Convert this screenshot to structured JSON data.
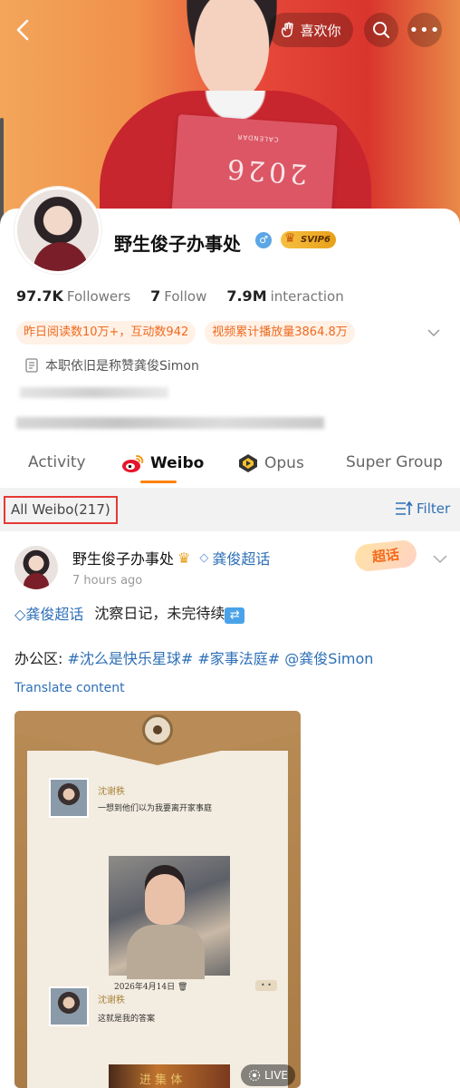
{
  "header": {
    "like_label": "喜欢你",
    "calendar_year": "2026",
    "calendar_word": "CALENDAR"
  },
  "profile": {
    "name": "野生俊子办事处",
    "gender_symbol": "♂",
    "vip_label": "SVIP6",
    "followers_count": "97.7K",
    "followers_label": "Followers",
    "follow_count": "7",
    "follow_label": "Follow",
    "interaction_count": "7.9M",
    "interaction_label": "interaction",
    "tags": [
      "昨日阅读数10万+，互动数942",
      "视频累计播放量3864.8万"
    ],
    "bio": "本职依旧是称赞龚俊Simon"
  },
  "tabs": [
    {
      "label": "Activity",
      "active": false
    },
    {
      "label": "Weibo",
      "active": true
    },
    {
      "label": "Opus",
      "active": false
    },
    {
      "label": "Super Group",
      "active": false
    }
  ],
  "filterbar": {
    "all_weibo_label": "All Weibo(217)",
    "filter_label": "Filter"
  },
  "post": {
    "author": "野生俊子办事处",
    "supertopic": "龚俊超话",
    "time": "7 hours ago",
    "badge": "超话",
    "line1_link": "龚俊超话",
    "line1_text": "沈察日记，未完待续",
    "line2_prefix": "办公区:",
    "line2_links": "#沈么是快乐星球# #家事法庭# @龚俊Simon",
    "translate_label": "Translate content",
    "image": {
      "entry1_name": "沈谢秩",
      "entry1_text": "一想到他们以为我要离开家事庭",
      "entry1_date": "2026年4月14日",
      "entry2_name": "沈谢秩",
      "entry2_text": "这就是我的答案",
      "photo2_text": "进 集 体",
      "live_label": "LIVE"
    }
  },
  "colors": {
    "accent_orange": "#ff8200",
    "link_blue": "#2d6fb6",
    "highlight_red": "#e53935"
  }
}
